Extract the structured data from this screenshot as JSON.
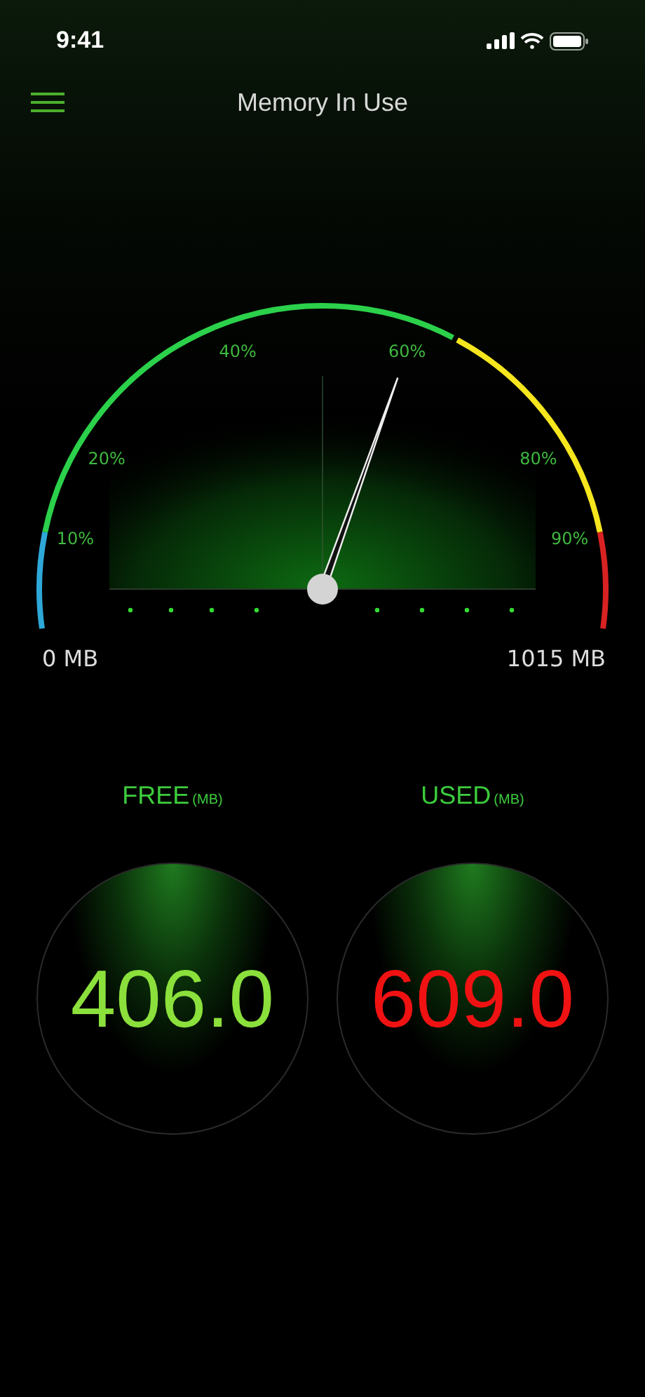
{
  "status_bar": {
    "time": "9:41"
  },
  "header": {
    "title": "Memory In Use"
  },
  "gauge": {
    "scale_labels": [
      "10%",
      "20%",
      "40%",
      "60%",
      "80%",
      "90%"
    ],
    "min_label": "0 MB",
    "max_label": "1015 MB"
  },
  "readouts": [
    {
      "kind": "free",
      "label": "FREE",
      "unit": "(MB)",
      "value": "406.0"
    },
    {
      "kind": "used",
      "label": "USED",
      "unit": "(MB)",
      "value": "609.0"
    }
  ]
}
